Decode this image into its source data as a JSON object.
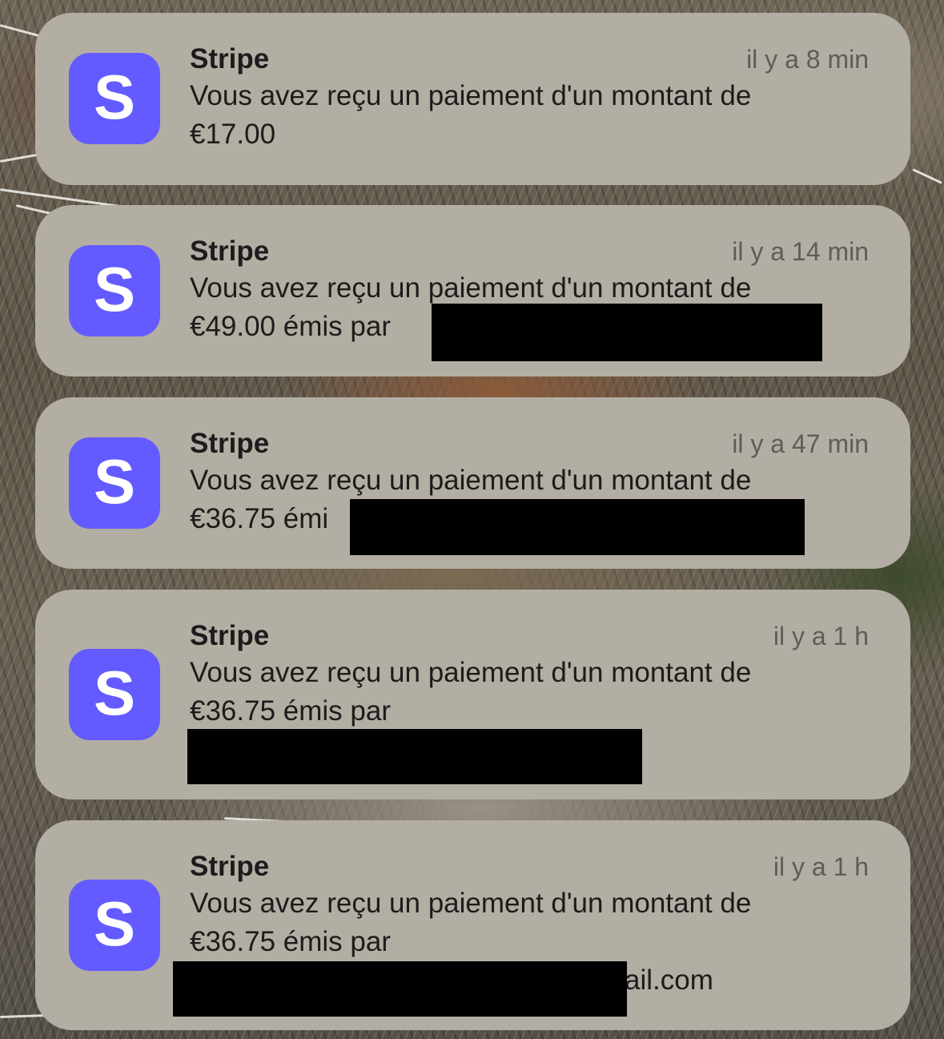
{
  "notifications": [
    {
      "app": "Stripe",
      "time": "il y a 8 min",
      "line1": "Vous avez reçu un paiement d'un montant de",
      "line2": "€17.00",
      "line3": ""
    },
    {
      "app": "Stripe",
      "time": "il y a 14 min",
      "line1": "Vous avez reçu un paiement d'un montant de",
      "line2": "€49.00 émis par",
      "line3": ""
    },
    {
      "app": "Stripe",
      "time": "il y a 47 min",
      "line1": "Vous avez reçu un paiement d'un montant de",
      "line2": "€36.75 émi",
      "line3": ""
    },
    {
      "app": "Stripe",
      "time": "il y a 1 h",
      "line1": "Vous avez reçu un paiement d'un montant de",
      "line2": "€36.75 émis par",
      "line3": ""
    },
    {
      "app": "Stripe",
      "time": "il y a 1 h",
      "line1": "Vous avez reçu un paiement d'un montant de",
      "line2": "€36.75 émis par",
      "line3": "ail.com"
    }
  ],
  "colors": {
    "stripe_brand": "#635bff",
    "card_background": "#b3aea3",
    "redaction": "#000000"
  },
  "icons": {
    "app_icon": "stripe-logo-icon"
  }
}
